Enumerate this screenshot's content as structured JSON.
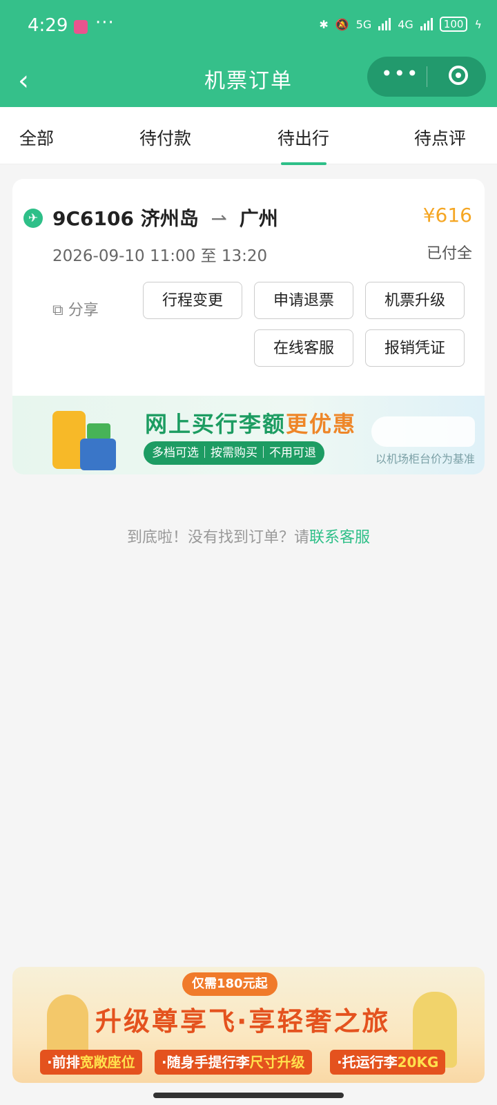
{
  "status_bar": {
    "time": "4:29",
    "more": "···",
    "net1": "5G",
    "net2": "4G",
    "battery": "100"
  },
  "nav": {
    "back_icon": "chevron-left-icon",
    "title": "机票订单",
    "more_icon": "more-dots-icon",
    "target_icon": "target-icon"
  },
  "tabs": [
    {
      "label": "全部"
    },
    {
      "label": "待付款"
    },
    {
      "label": "待出行",
      "active": true
    },
    {
      "label": "待点评"
    }
  ],
  "order": {
    "flight": "9C6106",
    "from": "济州岛",
    "to": "广州",
    "arrow": "⇀",
    "price": "¥616",
    "datetime": "2026-09-10 11:00 至 13:20",
    "status": "已付全",
    "share": "分享",
    "buttons": [
      "行程变更",
      "申请退票",
      "机票升级",
      "在线客服",
      "报销凭证"
    ]
  },
  "banner1": {
    "title_a": "网上买行李额",
    "title_b": "更优惠",
    "pill": "多档可选｜按需购买｜不用可退",
    "note": "以机场柜台价为基准"
  },
  "footer": {
    "text": "到底啦！没有找到订单？请",
    "link": "联系客服"
  },
  "banner2": {
    "tag": "仅需180元起",
    "title": "升级尊享飞·享轻奢之旅",
    "feature1_a": "·前排",
    "feature1_b": "宽敞座位",
    "feature2_a": "·随身手提行李",
    "feature2_b": "尺寸升级",
    "feature3_a": "·托运行李",
    "feature3_b": "20KG"
  },
  "colors": {
    "brand_green": "#35c08a",
    "price_orange": "#f5a623",
    "link_green": "#2ebf88"
  }
}
